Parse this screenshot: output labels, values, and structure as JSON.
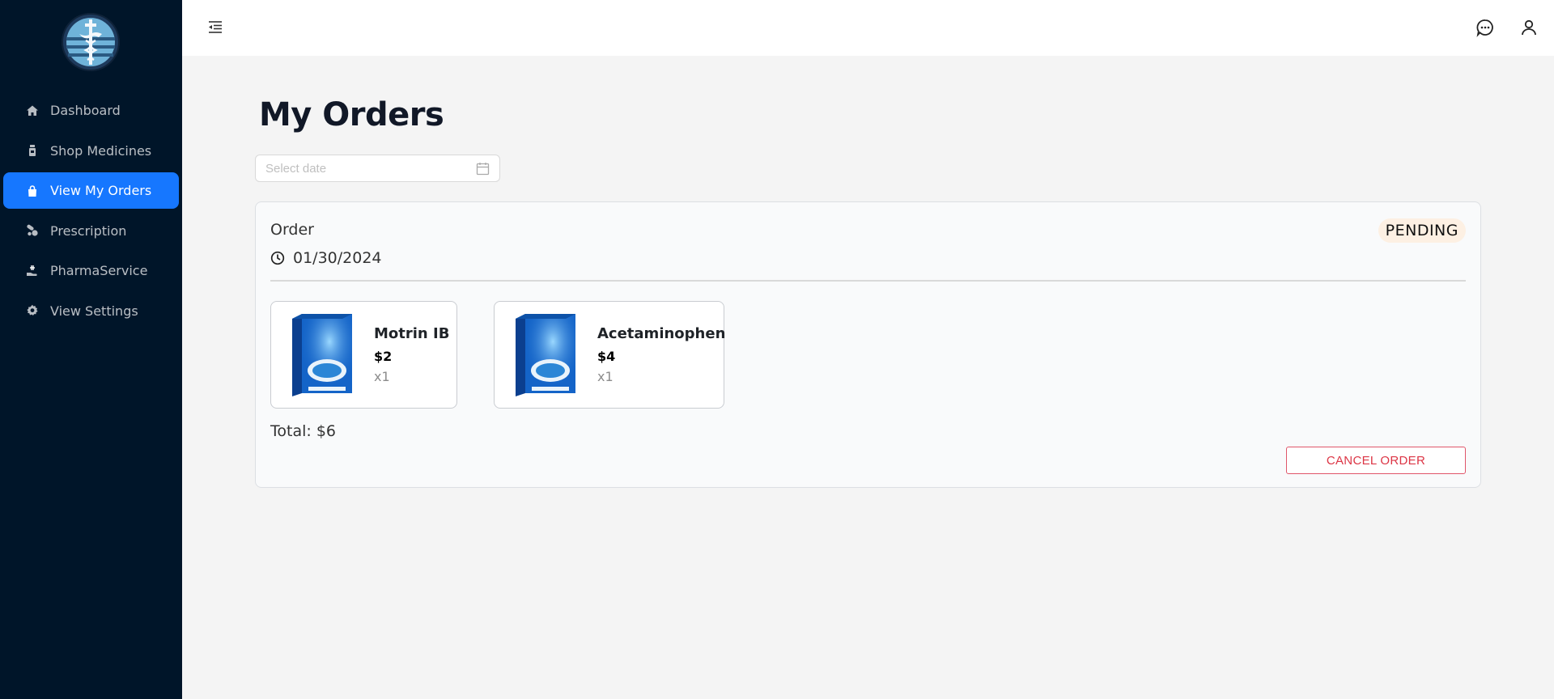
{
  "sidebar": {
    "logo_icon": "caduceus-logo",
    "items": [
      {
        "label": "Dashboard",
        "icon": "home-icon"
      },
      {
        "label": "Shop Medicines",
        "icon": "medicine-bottle-icon"
      },
      {
        "label": "View My Orders",
        "icon": "shopping-bag-icon",
        "active": true
      },
      {
        "label": "Prescription",
        "icon": "pills-icon"
      },
      {
        "label": "PharmaService",
        "icon": "hand-service-icon"
      },
      {
        "label": "View Settings",
        "icon": "gear-icon"
      }
    ]
  },
  "header": {
    "menu_icon": "menu-fold-icon",
    "right_icons": [
      "chat-icon",
      "user-icon"
    ]
  },
  "main": {
    "title": "My Orders",
    "date_filter": {
      "placeholder": "Select date",
      "value": "",
      "icon": "calendar-icon"
    },
    "order": {
      "label": "Order",
      "date": "01/30/2024",
      "status": "PENDING",
      "items": [
        {
          "name": "Motrin IB",
          "price": "$2",
          "qty": "x1"
        },
        {
          "name": "Acetaminophen",
          "price": "$4",
          "qty": "x1"
        }
      ],
      "total": "Total: $6",
      "cancel_label": "CANCEL ORDER"
    }
  },
  "colors": {
    "sidebar_bg": "#001529",
    "active_nav": "#1677ff",
    "danger": "#dc3545",
    "badge_bg": "#fdf0e3"
  }
}
